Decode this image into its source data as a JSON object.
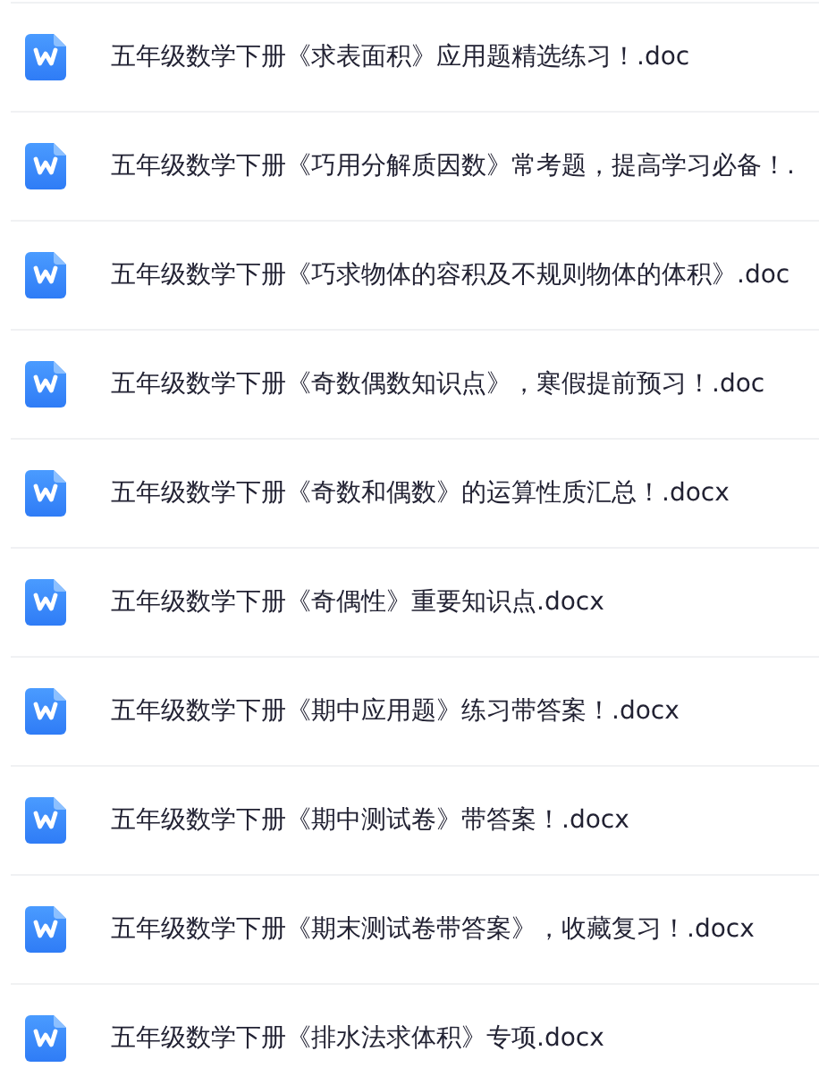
{
  "files": [
    {
      "name": "五年级数学下册《求表面积》应用题精选练习！.doc"
    },
    {
      "name": "五年级数学下册《巧用分解质因数》常考题，提高学习必备！."
    },
    {
      "name": "五年级数学下册《巧求物体的容积及不规则物体的体积》.doc"
    },
    {
      "name": "五年级数学下册《奇数偶数知识点》，寒假提前预习！.doc"
    },
    {
      "name": "五年级数学下册《奇数和偶数》的运算性质汇总！.docx"
    },
    {
      "name": "五年级数学下册《奇偶性》重要知识点.docx"
    },
    {
      "name": "五年级数学下册《期中应用题》练习带答案！.docx"
    },
    {
      "name": "五年级数学下册《期中测试卷》带答案！.docx"
    },
    {
      "name": "五年级数学下册《期末测试卷带答案》，收藏复习！.docx"
    },
    {
      "name": "五年级数学下册《排水法求体积》专项.docx"
    }
  ]
}
